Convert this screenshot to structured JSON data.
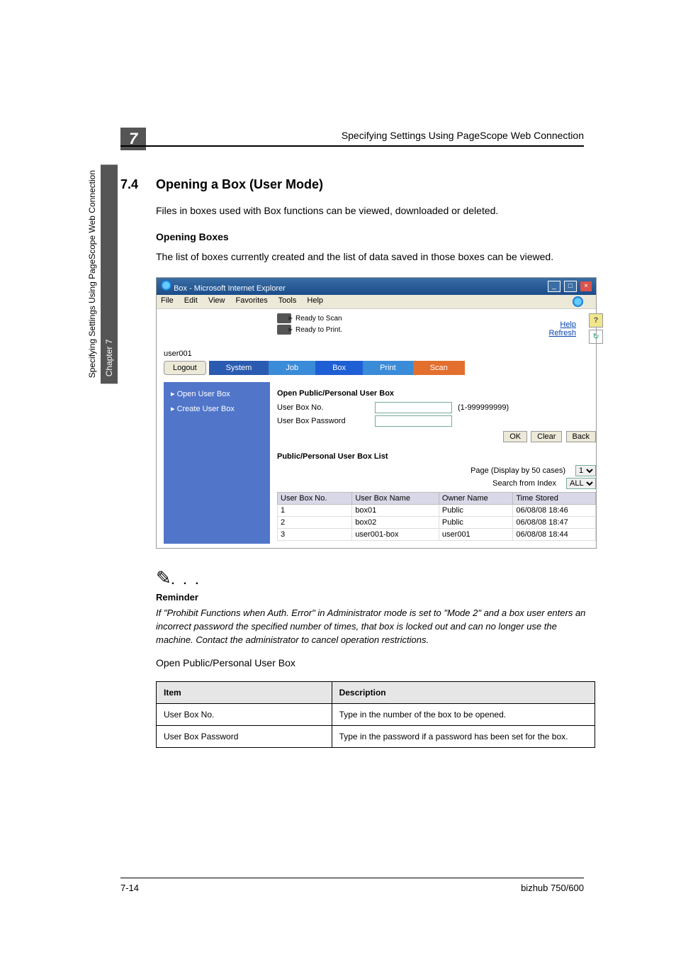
{
  "page": {
    "header_chapter_num": "7",
    "header_title": "Specifying Settings Using PageScope Web Connection",
    "side_chapter": "Chapter 7",
    "side_title": "Specifying Settings Using PageScope Web Connection",
    "section_num": "7.4",
    "section_title": "Opening a Box (User Mode)",
    "intro": "Files in boxes used with Box functions can be viewed, downloaded or deleted.",
    "sub_heading": "Opening Boxes",
    "sub_text": "The list of boxes currently created and the list of data saved in those boxes can be viewed.",
    "note_label": "Reminder",
    "note_text": "If \"Prohibit Functions when Auth. Error\" in Administrator mode is set to \"Mode 2\" and a box user enters an incorrect password the specified number of times, that box is locked out and can no longer use the machine. Contact the administrator to cancel operation restrictions.",
    "table_caption": "Open Public/Personal User Box",
    "desc_table": {
      "head_item": "Item",
      "head_desc": "Description",
      "rows": [
        {
          "item": "User Box No.",
          "desc": "Type in the number of the box to be opened."
        },
        {
          "item": "User Box Password",
          "desc": "Type in the password if a password has been set for the box."
        }
      ]
    },
    "footer_left": "7-14",
    "footer_right": "bizhub 750/600"
  },
  "screenshot": {
    "titlebar": "Box - Microsoft Internet Explorer",
    "menus": [
      "File",
      "Edit",
      "View",
      "Favorites",
      "Tools",
      "Help"
    ],
    "status": {
      "scan": "Ready to Scan",
      "print": "Ready to Print."
    },
    "links": {
      "help": "Help",
      "refresh": "Refresh"
    },
    "user": "user001",
    "logout": "Logout",
    "tabs": {
      "system": "System",
      "job": "Job",
      "box": "Box",
      "print": "Print",
      "scan": "Scan"
    },
    "sidebar": {
      "open": "Open User Box",
      "create": "Create User Box"
    },
    "open_section_title": "Open Public/Personal User Box",
    "form": {
      "box_no_label": "User Box No.",
      "box_no_range": "(1-999999999)",
      "password_label": "User Box Password",
      "ok": "OK",
      "clear": "Clear",
      "back": "Back"
    },
    "list_title": "Public/Personal User Box List",
    "page_label": "Page (Display by 50 cases)",
    "page_value": "1",
    "search_label": "Search from Index",
    "search_value": "ALL",
    "columns": {
      "no": "User Box No.",
      "name": "User Box Name",
      "owner": "Owner Name",
      "time": "Time Stored"
    },
    "rows": [
      {
        "no": "1",
        "name": "box01",
        "owner": "Public",
        "time": "06/08/08 18:46"
      },
      {
        "no": "2",
        "name": "box02",
        "owner": "Public",
        "time": "06/08/08 18:47"
      },
      {
        "no": "3",
        "name": "user001-box",
        "owner": "user001",
        "time": "06/08/08 18:44"
      }
    ]
  }
}
